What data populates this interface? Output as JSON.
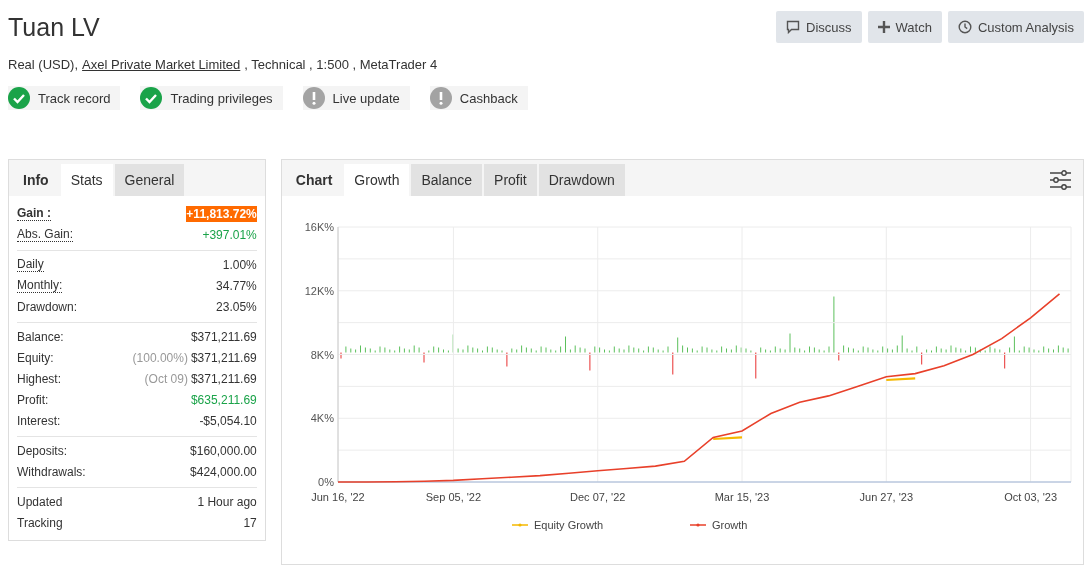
{
  "header": {
    "title": "Tuan LV",
    "actions": [
      {
        "label": "Discuss"
      },
      {
        "label": "Watch"
      },
      {
        "label": "Custom Analysis"
      }
    ],
    "subtitle": {
      "before": "Real (USD),",
      "link": "Axel Private Market Limited",
      "after": ", Technical , 1:500 , MetaTrader 4"
    },
    "badges": [
      {
        "label": "Track record",
        "verified": true
      },
      {
        "label": "Trading privileges",
        "verified": true
      },
      {
        "label": "Live update",
        "verified": false
      },
      {
        "label": "Cashback",
        "verified": false
      }
    ]
  },
  "stats_panel": {
    "heading": "Info",
    "tabs": [
      {
        "label": "Stats",
        "selected": true
      },
      {
        "label": "General",
        "selected": false
      }
    ],
    "groups": [
      [
        {
          "label": "Gain :",
          "value": "+11,813.72%",
          "kind": "highlight",
          "underlined": true,
          "bold": true
        },
        {
          "label": "Abs. Gain:",
          "value": "+397.01%",
          "kind": "positive",
          "underlined": true,
          "bold": false
        }
      ],
      [
        {
          "label": "Daily",
          "value": "1.00%",
          "kind": "plain",
          "underlined": true,
          "bold": false
        },
        {
          "label": "Monthly:",
          "value": "34.77%",
          "kind": "plain",
          "underlined": true,
          "bold": false
        },
        {
          "label": "Drawdown:",
          "value": "23.05%",
          "kind": "plain",
          "underlined": false,
          "bold": false
        }
      ],
      [
        {
          "label": "Balance:",
          "value": "$371,211.69",
          "kind": "plain",
          "underlined": false,
          "bold": false
        },
        {
          "label": "Equity:",
          "note": "(100.00%)",
          "value": "$371,211.69",
          "kind": "plain",
          "underlined": false,
          "bold": false
        },
        {
          "label": "Highest:",
          "note": "(Oct 09)",
          "value": "$371,211.69",
          "kind": "plain",
          "underlined": false,
          "bold": false
        },
        {
          "label": "Profit:",
          "value": "$635,211.69",
          "kind": "positive",
          "underlined": false,
          "bold": false
        },
        {
          "label": "Interest:",
          "value": "-$5,054.10",
          "kind": "plain",
          "underlined": false,
          "bold": false
        }
      ],
      [
        {
          "label": "Deposits:",
          "value": "$160,000.00",
          "kind": "plain",
          "underlined": false,
          "bold": false
        },
        {
          "label": "Withdrawals:",
          "value": "$424,000.00",
          "kind": "plain",
          "underlined": false,
          "bold": false
        }
      ],
      [
        {
          "label": "Updated",
          "value": "1 Hour ago",
          "kind": "plain",
          "underlined": false,
          "bold": false
        },
        {
          "label": "Tracking",
          "value": "17",
          "kind": "plain",
          "underlined": false,
          "bold": false
        }
      ]
    ]
  },
  "chart_panel": {
    "heading": "Chart",
    "tabs": [
      {
        "label": "Growth",
        "selected": true
      },
      {
        "label": "Balance",
        "selected": false
      },
      {
        "label": "Profit",
        "selected": false
      },
      {
        "label": "Drawdown",
        "selected": false
      }
    ],
    "chart_data": {
      "type": "line",
      "grid": true,
      "legend": "bottom",
      "categories": [
        "Jun 16, '22",
        null,
        null,
        null,
        "Sep 05, '22",
        null,
        null,
        null,
        null,
        "Dec 07, '22",
        null,
        null,
        null,
        null,
        "Mar 15, '23",
        null,
        null,
        null,
        null,
        "Jun 27, '23",
        null,
        null,
        null,
        null,
        "Oct 03, '23",
        null
      ],
      "ylim": [
        0,
        16000
      ],
      "yticks": [
        {
          "value": 0,
          "label": "0%"
        },
        {
          "value": 4000,
          "label": "4K%"
        },
        {
          "value": 8000,
          "label": "8K%"
        },
        {
          "value": 12000,
          "label": "12K%"
        },
        {
          "value": 16000,
          "label": "16K%"
        }
      ],
      "series": [
        {
          "name": "Equity Growth",
          "color": "#f5b800",
          "values": [
            null,
            null,
            null,
            null,
            null,
            null,
            null,
            null,
            null,
            null,
            null,
            null,
            null,
            2700,
            2800,
            null,
            null,
            null,
            null,
            6400,
            6500,
            null,
            null,
            null,
            null,
            null
          ]
        },
        {
          "name": "Growth",
          "color": "#e8402a",
          "values": [
            0,
            0,
            20,
            50,
            100,
            200,
            300,
            400,
            550,
            700,
            850,
            1000,
            1300,
            2800,
            3200,
            4300,
            5000,
            5400,
            6000,
            6600,
            6800,
            7300,
            8000,
            9000,
            10300,
            11800
          ]
        }
      ]
    }
  }
}
